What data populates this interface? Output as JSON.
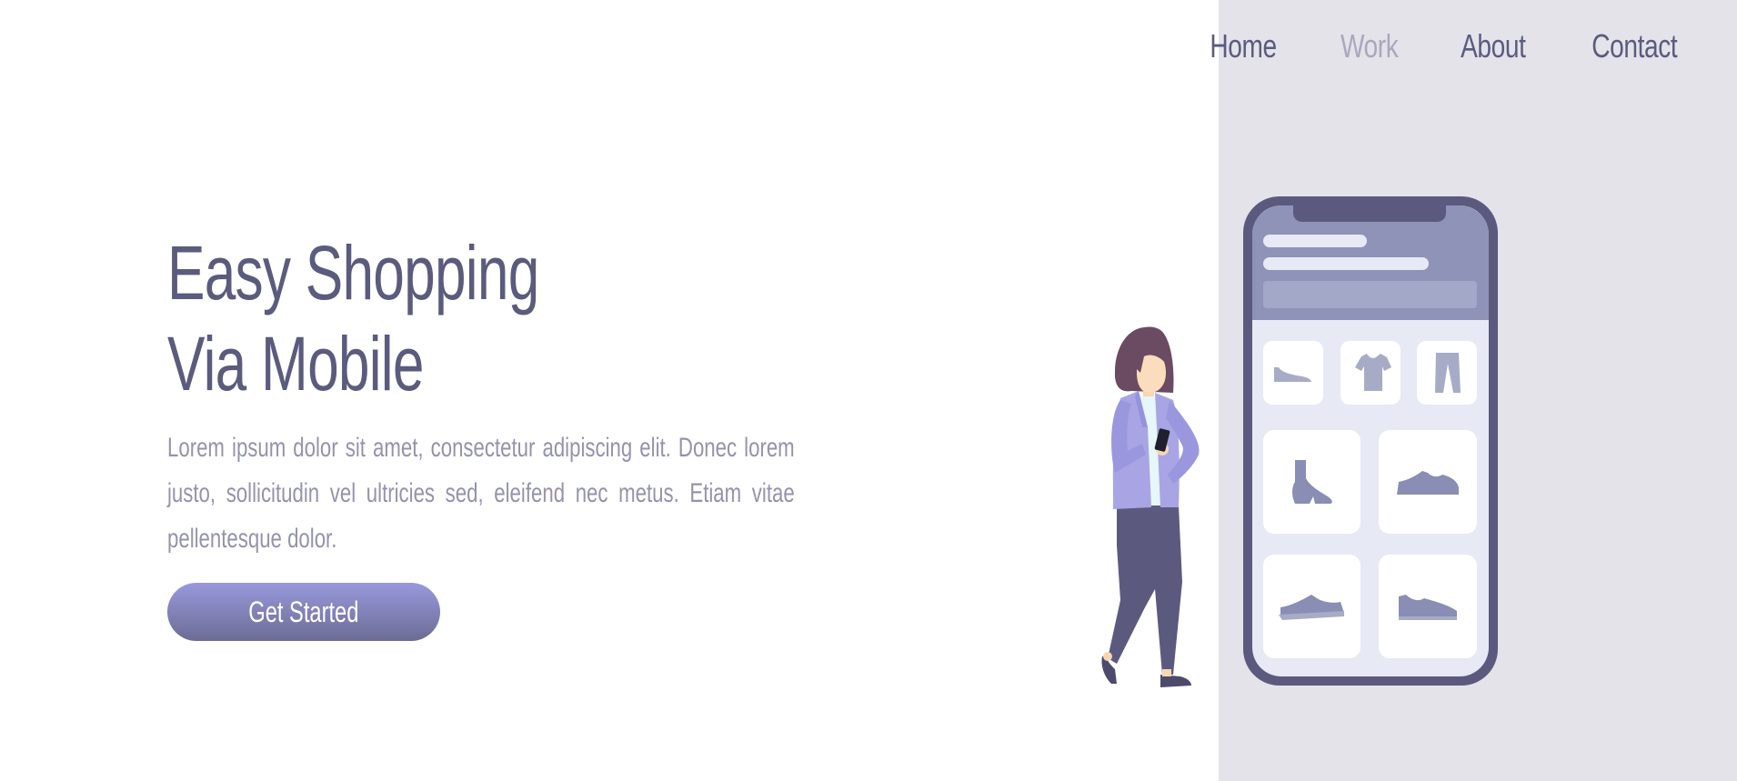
{
  "nav": {
    "items": [
      {
        "label": "Home",
        "active": false
      },
      {
        "label": "Work",
        "active": true
      },
      {
        "label": "About",
        "active": false
      },
      {
        "label": "Contact",
        "active": false
      }
    ]
  },
  "hero": {
    "title_line1": "Easy Shopping",
    "title_line2": "Via Mobile",
    "description": "Lorem ipsum dolor sit amet, consectetur adipiscing elit. Donec lorem justo, sollicitudin vel ultricies sed, eleifend nec metus. Etiam vitae pellentesque dolor.",
    "cta_label": "Get Started"
  },
  "illustration": {
    "phone_tiles_top": [
      "shoe-flat-icon",
      "tshirt-icon",
      "pants-icon"
    ],
    "phone_tiles_grid": [
      "boot-icon",
      "sneaker-icon",
      "sneaker-icon",
      "sneaker-icon"
    ]
  },
  "colors": {
    "primary_text": "#5b5b7e",
    "muted_text": "#9493ad",
    "active_nav": "#a9a8bd",
    "panel_bg": "#e4e3ea",
    "button_top": "#9899dc",
    "button_bottom": "#6d6c95",
    "phone_frame": "#5b5a7e",
    "phone_header": "#8e93b7"
  }
}
